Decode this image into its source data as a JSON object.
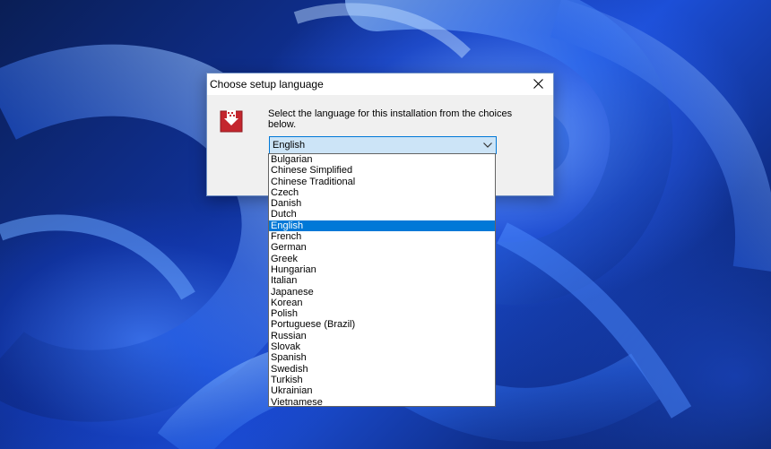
{
  "dialog": {
    "title": "Choose setup language",
    "prompt": "Select the language for this installation from the choices below.",
    "selected_language": "English",
    "icons": {
      "app": "installer-box-icon",
      "close": "close-icon",
      "dropdown": "chevron-down-icon"
    }
  },
  "languages": [
    {
      "label": "Bulgarian",
      "selected": false
    },
    {
      "label": "Chinese Simplified",
      "selected": false
    },
    {
      "label": "Chinese Traditional",
      "selected": false
    },
    {
      "label": "Czech",
      "selected": false
    },
    {
      "label": "Danish",
      "selected": false
    },
    {
      "label": "Dutch",
      "selected": false
    },
    {
      "label": "English",
      "selected": true
    },
    {
      "label": "French",
      "selected": false
    },
    {
      "label": "German",
      "selected": false
    },
    {
      "label": "Greek",
      "selected": false
    },
    {
      "label": "Hungarian",
      "selected": false
    },
    {
      "label": "Italian",
      "selected": false
    },
    {
      "label": "Japanese",
      "selected": false
    },
    {
      "label": "Korean",
      "selected": false
    },
    {
      "label": "Polish",
      "selected": false
    },
    {
      "label": "Portuguese (Brazil)",
      "selected": false
    },
    {
      "label": "Russian",
      "selected": false
    },
    {
      "label": "Slovak",
      "selected": false
    },
    {
      "label": "Spanish",
      "selected": false
    },
    {
      "label": "Swedish",
      "selected": false
    },
    {
      "label": "Turkish",
      "selected": false
    },
    {
      "label": "Ukrainian",
      "selected": false
    },
    {
      "label": "Vietnamese",
      "selected": false
    }
  ],
  "colors": {
    "selection": "#0078d7",
    "combo_background": "#cce4f7",
    "icon_red": "#c4262e"
  }
}
